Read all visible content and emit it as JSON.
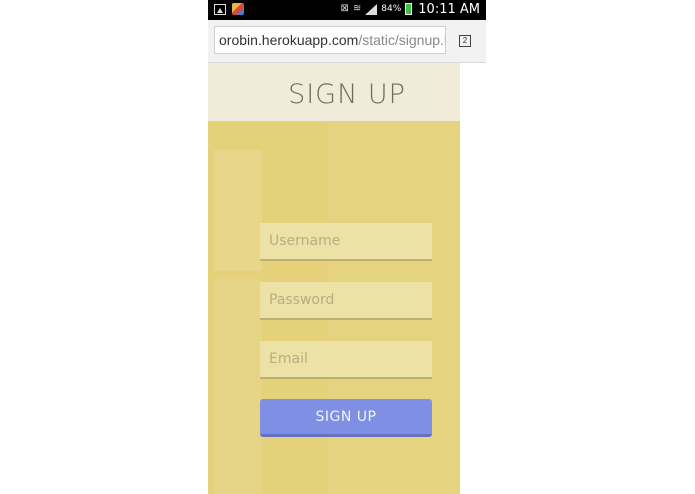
{
  "status_bar": {
    "left_icons": [
      "image-icon",
      "store-icon"
    ],
    "right_icons": [
      "nfc-icon",
      "wifi-icon",
      "signal-icon"
    ],
    "battery_percent": "84%",
    "time": "10:11 AM"
  },
  "browser": {
    "url_host": "orobin.herokuapp.com",
    "url_path": "/static/signup.l",
    "tab_count": "2"
  },
  "page": {
    "title": "SIGN UP",
    "username_placeholder": "Username",
    "password_placeholder": "Password",
    "email_placeholder": "Email",
    "submit_label": "SIGN UP"
  },
  "colors": {
    "header_bg": "#f1ecd9",
    "form_bg": "#e5d17a",
    "field_bg": "#ede2a6",
    "button_bg": "#7f8fe3"
  }
}
